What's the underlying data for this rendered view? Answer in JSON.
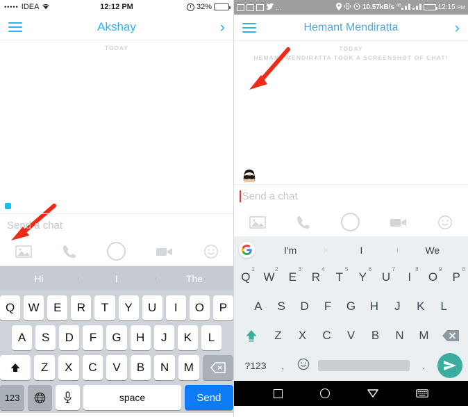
{
  "ios": {
    "status": {
      "signal_dots": "•••••",
      "carrier": "IDEA",
      "wifi_icon": "wifi-icon",
      "time": "12:12 PM",
      "battery_percent": "32%",
      "battery_level": 32,
      "alarm_icon": "do-not-disturb-icon"
    },
    "header": {
      "menu_icon": "hamburger-icon",
      "title": "Akshay",
      "forward_icon": "chevron-right-icon"
    },
    "chat": {
      "day_label": "TODAY",
      "presence_indicator": "blue-square-dot"
    },
    "input": {
      "placeholder": "Send a chat",
      "value": ""
    },
    "actions": [
      {
        "name": "gallery-icon",
        "label": "Gallery"
      },
      {
        "name": "phone-icon",
        "label": "Call"
      },
      {
        "name": "camera-icon",
        "label": "Camera"
      },
      {
        "name": "video-icon",
        "label": "Video call"
      },
      {
        "name": "sticker-icon",
        "label": "Stickers"
      }
    ],
    "keyboard": {
      "suggestions": [
        "Hi",
        "I",
        "The"
      ],
      "row1": [
        "Q",
        "W",
        "E",
        "R",
        "T",
        "Y",
        "U",
        "I",
        "O",
        "P"
      ],
      "row2": [
        "A",
        "S",
        "D",
        "F",
        "G",
        "H",
        "J",
        "K",
        "L"
      ],
      "row3": [
        "Z",
        "X",
        "C",
        "V",
        "B",
        "N",
        "M"
      ],
      "shift_label": "shift-icon",
      "delete_label": "backspace-icon",
      "numeric_label": "123",
      "globe_label": "globe-icon",
      "mic_label": "mic-icon",
      "space_label": "space",
      "send_label": "Send"
    }
  },
  "android": {
    "status": {
      "notif_icons": [
        "image-notif-icon",
        "mail-notif-icon",
        "mail-notif-icon",
        "twitter-icon",
        "more-icon"
      ],
      "location_icon": "location-pin-icon",
      "vibrate_icon": "vibrate-icon",
      "alarm_icon": "alarm-clock-icon",
      "data_speed": "10.57kB/s",
      "sim1_label": "40",
      "sim2_label": "46",
      "signal_icon": "signal-bars-icon",
      "battery_level": 55,
      "time": "12:15",
      "time_suffix": "PM"
    },
    "header": {
      "menu_icon": "hamburger-icon",
      "title": "Hemant Mendiratta",
      "forward_icon": "chevron-right-icon"
    },
    "chat": {
      "day_label": "TODAY",
      "event_label": "HEMANT MENDIRATTA TOOK A SCREENSHOT OF CHAT!",
      "presence_indicator": "bitmoji-avatar"
    },
    "input": {
      "placeholder": "Send a chat",
      "value": "",
      "caret_color": "#e8392a"
    },
    "actions": [
      {
        "name": "gallery-icon",
        "label": "Gallery"
      },
      {
        "name": "phone-icon",
        "label": "Call"
      },
      {
        "name": "camera-icon",
        "label": "Camera"
      },
      {
        "name": "video-icon",
        "label": "Video call"
      },
      {
        "name": "sticker-icon",
        "label": "Stickers"
      }
    ],
    "keyboard": {
      "google_logo": "G",
      "suggestions": [
        "I'm",
        "I",
        "We"
      ],
      "row1": [
        "Q",
        "W",
        "E",
        "R",
        "T",
        "Y",
        "U",
        "I",
        "O",
        "P"
      ],
      "row1_numbers": [
        "1",
        "2",
        "3",
        "4",
        "5",
        "6",
        "7",
        "8",
        "9",
        "0"
      ],
      "row2": [
        "A",
        "S",
        "D",
        "F",
        "G",
        "H",
        "J",
        "K",
        "L"
      ],
      "row3": [
        "Z",
        "X",
        "C",
        "V",
        "B",
        "N",
        "M"
      ],
      "shift_label": "shift-icon",
      "delete_label": "backspace-icon",
      "symbols_label": "?123",
      "comma_label": ",",
      "emoji_label": "emoji-icon",
      "space_label": "",
      "period_label": ".",
      "send_label": "send-icon"
    },
    "navbar": {
      "recents_icon": "square-recents-icon",
      "home_icon": "circle-home-icon",
      "back_icon": "triangle-back-icon",
      "keyboard_icon": "hide-keyboard-icon"
    }
  },
  "annotations": {
    "arrow_color": "#ee2a18",
    "arrows": [
      {
        "name": "arrow-pointing-to-presence-dot",
        "target": "ios presence indicator"
      },
      {
        "name": "arrow-pointing-to-bitmoji",
        "target": "android bitmoji avatar"
      }
    ]
  }
}
